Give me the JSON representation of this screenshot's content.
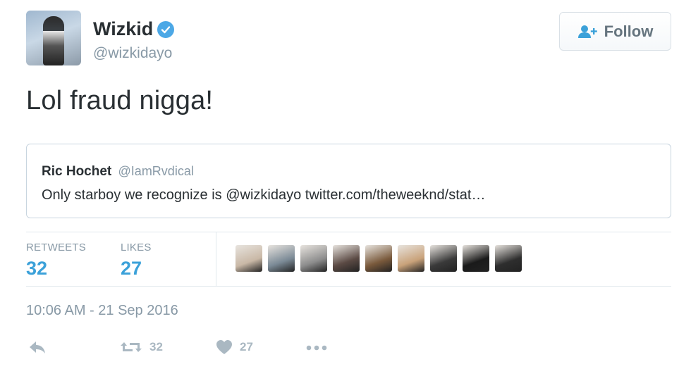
{
  "tweet": {
    "author_name": "Wizkid",
    "author_handle": "@wizkidayo",
    "follow_label": "Follow",
    "text": "Lol fraud nigga!",
    "quoted": {
      "name": "Ric Hochet",
      "handle": "@IamRvdical",
      "text": "Only starboy we recognize is @wizkidayo twitter.com/theweeknd/stat…"
    },
    "stats": {
      "retweets_label": "RETWEETS",
      "retweets_value": "32",
      "likes_label": "LIKES",
      "likes_value": "27"
    },
    "timestamp": "10:06 AM - 21 Sep 2016",
    "actions": {
      "retweet_count": "32",
      "like_count": "27"
    }
  },
  "colors": {
    "accent": "#3ba1d9",
    "verified": "#4ca8e6",
    "muted": "#8899a6",
    "action": "#aab8c2"
  },
  "icons": [
    "verified-badge-icon",
    "add-user-icon",
    "reply-icon",
    "retweet-icon",
    "heart-icon",
    "more-icon"
  ],
  "liker_avatars": [
    {
      "color": "#c9b8a6"
    },
    {
      "color": "#7b8a96"
    },
    {
      "color": "#8d8d8d"
    },
    {
      "color": "#5b4a44"
    },
    {
      "color": "#7a5a3c"
    },
    {
      "color": "#c9a27a"
    },
    {
      "color": "#3a3a3a"
    },
    {
      "color": "#1a1a1a"
    },
    {
      "color": "#2e2e2e"
    }
  ]
}
